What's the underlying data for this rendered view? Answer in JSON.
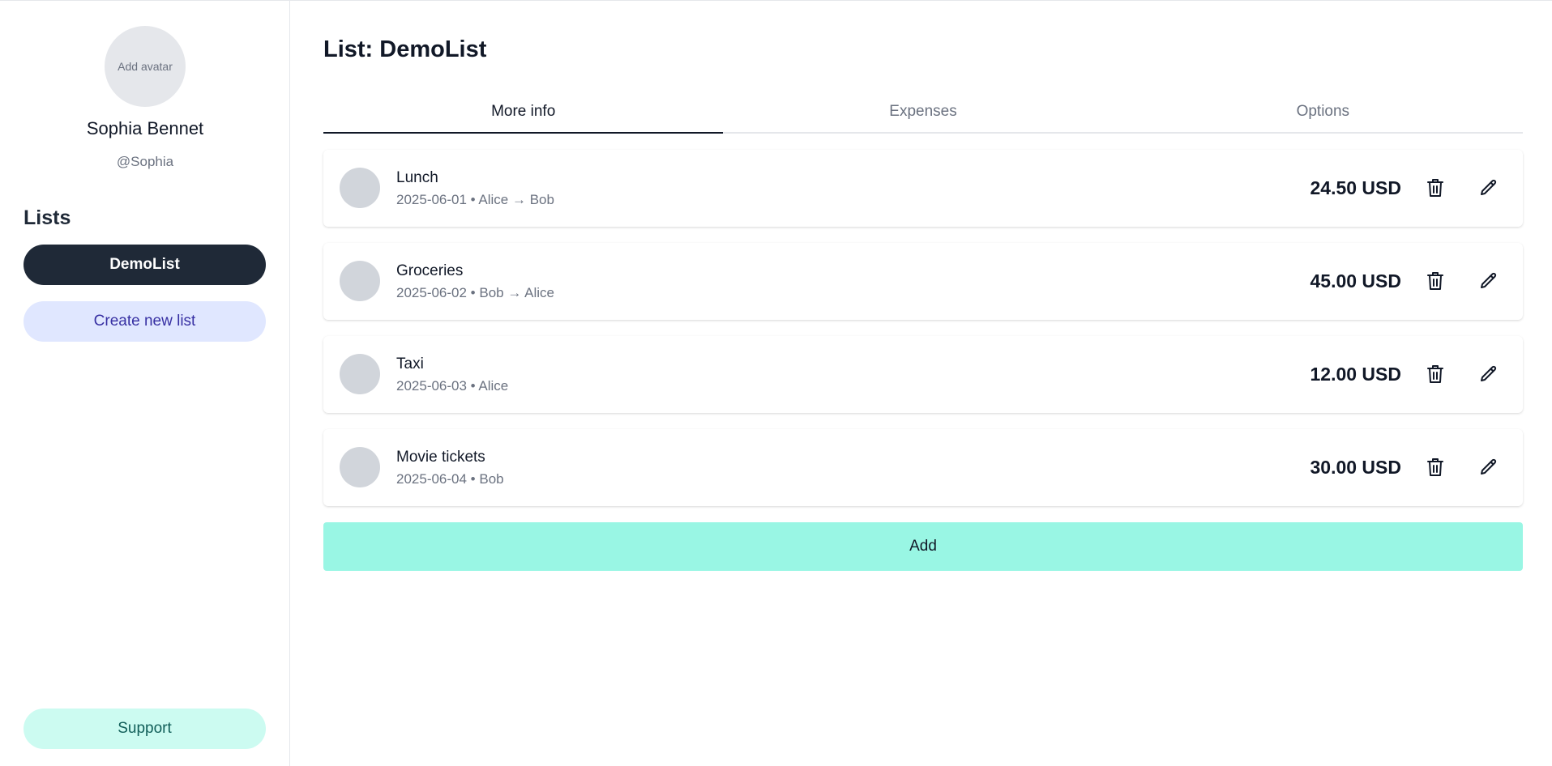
{
  "sidebar": {
    "avatar_placeholder": "Add avatar",
    "user_name": "Sophia Bennet",
    "user_handle": "@Sophia",
    "lists_heading": "Lists",
    "active_list": "DemoList",
    "create_list_label": "Create new list",
    "support_label": "Support"
  },
  "main": {
    "title": "List: DemoList",
    "tabs": [
      {
        "label": "More info",
        "active": true
      },
      {
        "label": "Expenses",
        "active": false
      },
      {
        "label": "Options",
        "active": false
      }
    ],
    "expenses": [
      {
        "name": "Lunch",
        "meta": "2025-06-01 • Alice → Bob",
        "amount": "24.50 USD"
      },
      {
        "name": "Groceries",
        "meta": "2025-06-02 • Bob → Alice",
        "amount": "45.00 USD"
      },
      {
        "name": "Taxi",
        "meta": "2025-06-03 • Alice",
        "amount": "12.00 USD"
      },
      {
        "name": "Movie tickets",
        "meta": "2025-06-04 • Bob",
        "amount": "30.00 USD"
      }
    ],
    "add_label": "Add"
  },
  "icons": {
    "delete": "trash-icon",
    "edit": "pencil-icon"
  },
  "colors": {
    "active_pill": "#1f2937",
    "create_pill": "#e0e7ff",
    "support_pill": "#ccfbf1",
    "add_button": "#99f6e4"
  }
}
